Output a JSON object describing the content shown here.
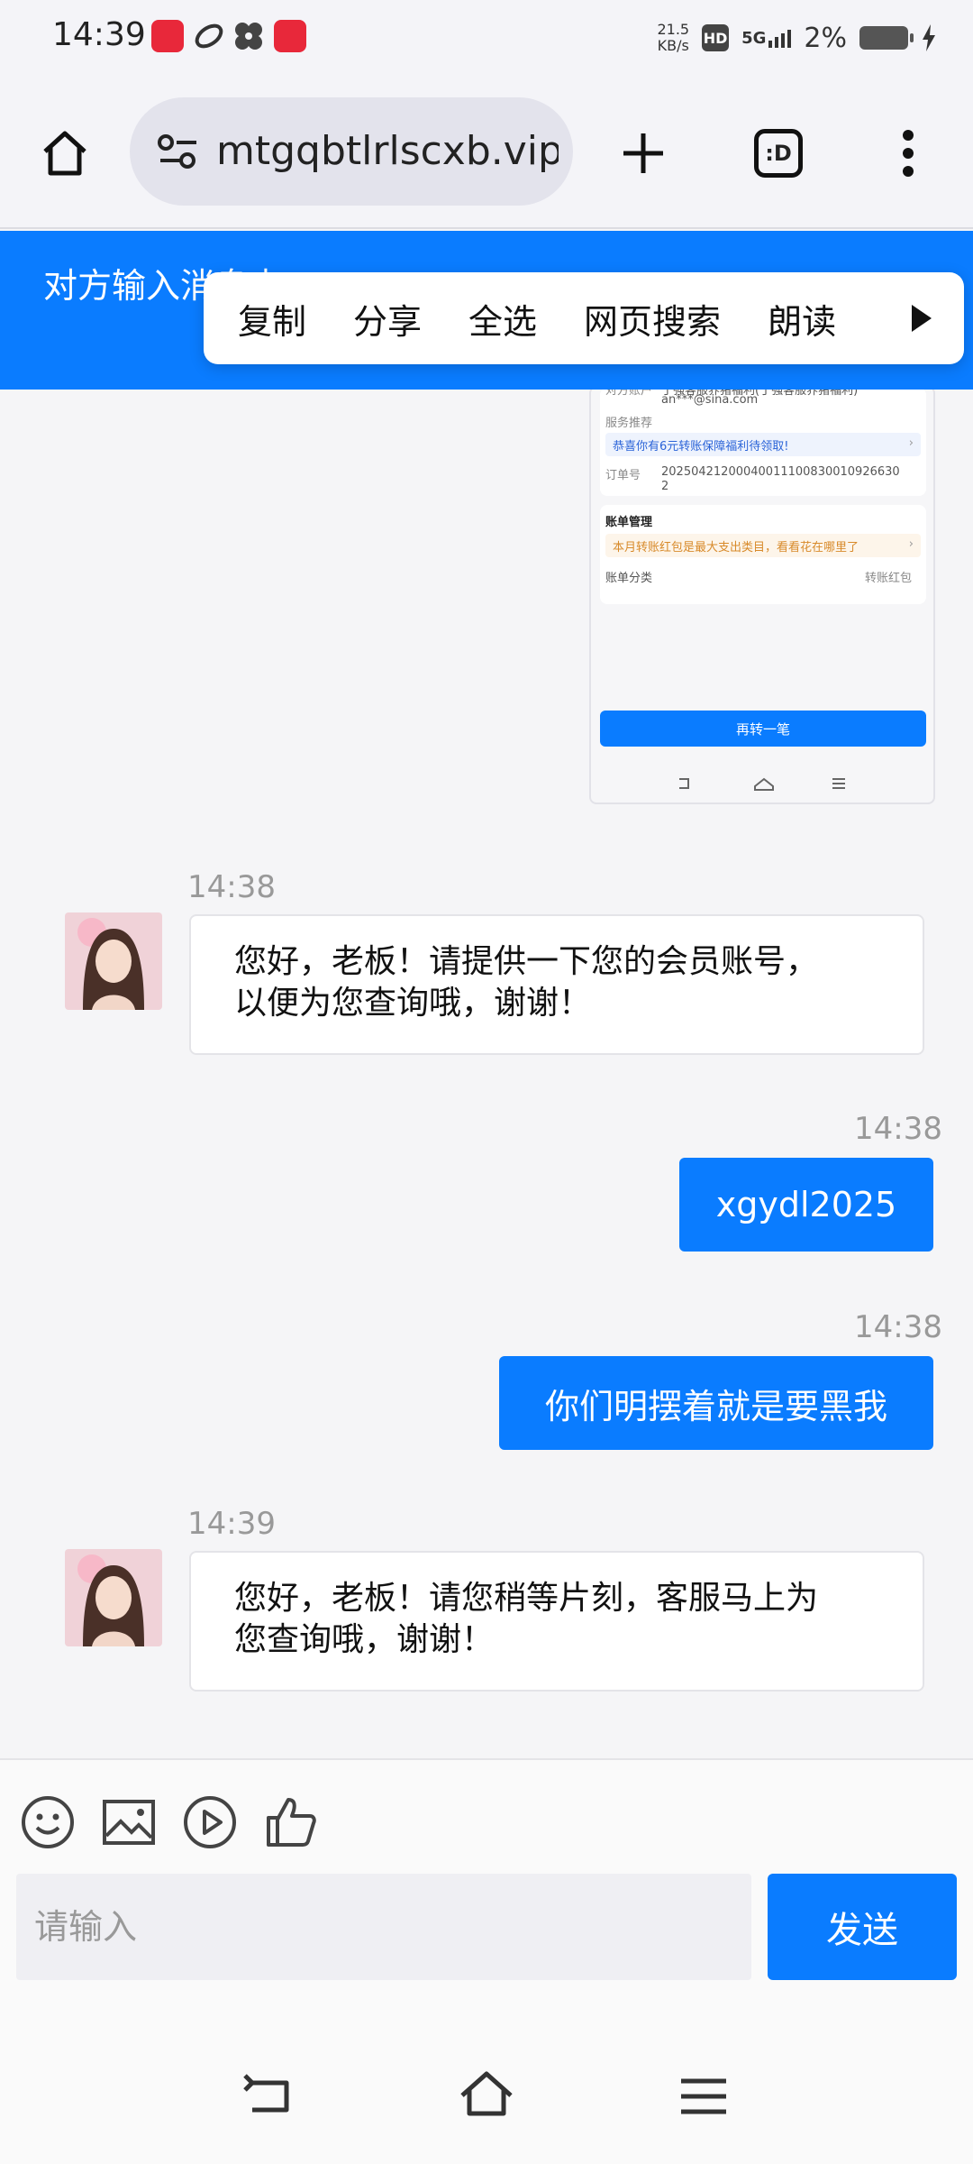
{
  "status_bar": {
    "time": "14:39",
    "net_speed_value": "21.5",
    "net_speed_unit": "KB/s",
    "hd": "HD",
    "signal": "5G",
    "battery": "2%"
  },
  "browser": {
    "url": "mtgqbtlrlscxb.vip",
    "tab_badge": ":D"
  },
  "header": {
    "title": "对方输入消息中"
  },
  "context_menu": {
    "items": [
      "复制",
      "分享",
      "全选",
      "网页搜索",
      "朗读"
    ]
  },
  "shared_screenshot": {
    "field1_label": "对方账户",
    "field1_value_line1": "丁强客服养猪福利(丁强客服养猪福利)",
    "field1_value_line2": "an***@sina.com",
    "service_label": "服务推荐",
    "service_banner": "恭喜你有6元转账保障福利待领取!",
    "order_label": "订单号",
    "order_value_line1": "20250421200040011100830010926630",
    "order_value_line2": "2",
    "bill_title": "账单管理",
    "bill_banner": "本月转账红包是最大支出类目，看看花在哪里了",
    "bill_category_label": "账单分类",
    "bill_category_value": "转账红包",
    "button": "再转一笔"
  },
  "messages": [
    {
      "side": "in",
      "time": "14:38",
      "text_line1": "您好，老板！请提供一下您的会员账号，",
      "text_line2": "以便为您查询哦，谢谢！"
    },
    {
      "side": "out",
      "time": "14:38",
      "text": "xgydl2025"
    },
    {
      "side": "out",
      "time": "14:38",
      "text": "你们明摆着就是要黑我"
    },
    {
      "side": "in",
      "time": "14:39",
      "text_line1": "您好，老板！请您稍等片刻，客服马上为",
      "text_line2": "您查询哦，谢谢！"
    }
  ],
  "composer": {
    "placeholder": "请输入",
    "send_label": "发送"
  },
  "colors": {
    "accent": "#0a7cff",
    "background": "#f5f5f7"
  },
  "icons": [
    "home-icon",
    "site-settings-icon",
    "new-tab-icon",
    "tabs-icon",
    "more-icon",
    "emoji-icon",
    "image-icon",
    "video-icon",
    "thumbs-up-icon",
    "back-icon",
    "home-nav-icon",
    "recents-icon"
  ]
}
